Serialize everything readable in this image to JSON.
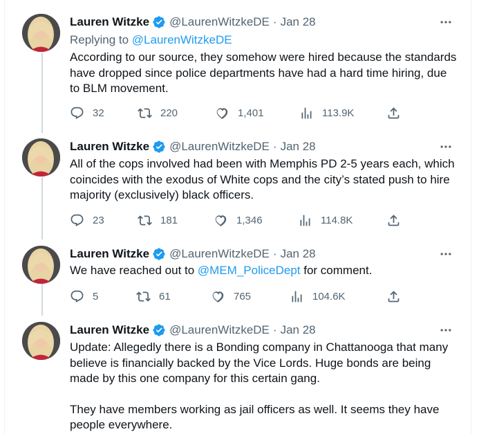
{
  "colors": {
    "link": "#1d9bf0",
    "muted": "#536471",
    "text": "#0f1419",
    "verified_badge": "#1d9bf0"
  },
  "tweets": [
    {
      "author_name": "Lauren Witzke",
      "handle": "@LaurenWitzkeDE",
      "separator": "·",
      "date": "Jan 28",
      "replying_label": "Replying to",
      "replying_handle": "@LaurenWitzkeDE",
      "text": "According to our source, they somehow were hired because the standards have dropped since police departments have had a hard time hiring, due to BLM movement.",
      "replies": "32",
      "retweets": "220",
      "likes": "1,401",
      "views": "113.9K"
    },
    {
      "author_name": "Lauren Witzke",
      "handle": "@LaurenWitzkeDE",
      "separator": "·",
      "date": "Jan 28",
      "text": "All of the cops involved had been with Memphis PD 2-5 years each, which coincides with the exodus of White cops and the city’s stated push to hire majority (exclusively) black officers.",
      "replies": "23",
      "retweets": "181",
      "likes": "1,346",
      "views": "114.8K"
    },
    {
      "author_name": "Lauren Witzke",
      "handle": "@LaurenWitzkeDE",
      "separator": "·",
      "date": "Jan 28",
      "text_before": "We have reached out to ",
      "mention": "@MEM_PoliceDept",
      "text_after": " for comment.",
      "replies": "5",
      "retweets": "61",
      "likes": "765",
      "views": "104.6K"
    },
    {
      "author_name": "Lauren Witzke",
      "handle": "@LaurenWitzkeDE",
      "separator": "·",
      "date": "Jan 28",
      "paragraph1": "Update: Allegedly there is a Bonding company in Chattanooga that many believe is financially backed by the Vice Lords. Huge bonds are being made by this one company for this certain gang.",
      "paragraph2": "They have members working as jail officers as well. It seems they have people everywhere."
    }
  ],
  "icons": {
    "reply": "reply-icon",
    "retweet": "retweet-icon",
    "like": "like-icon",
    "views": "views-icon",
    "share": "share-icon",
    "more": "more-icon",
    "verified": "verified-badge-icon"
  }
}
